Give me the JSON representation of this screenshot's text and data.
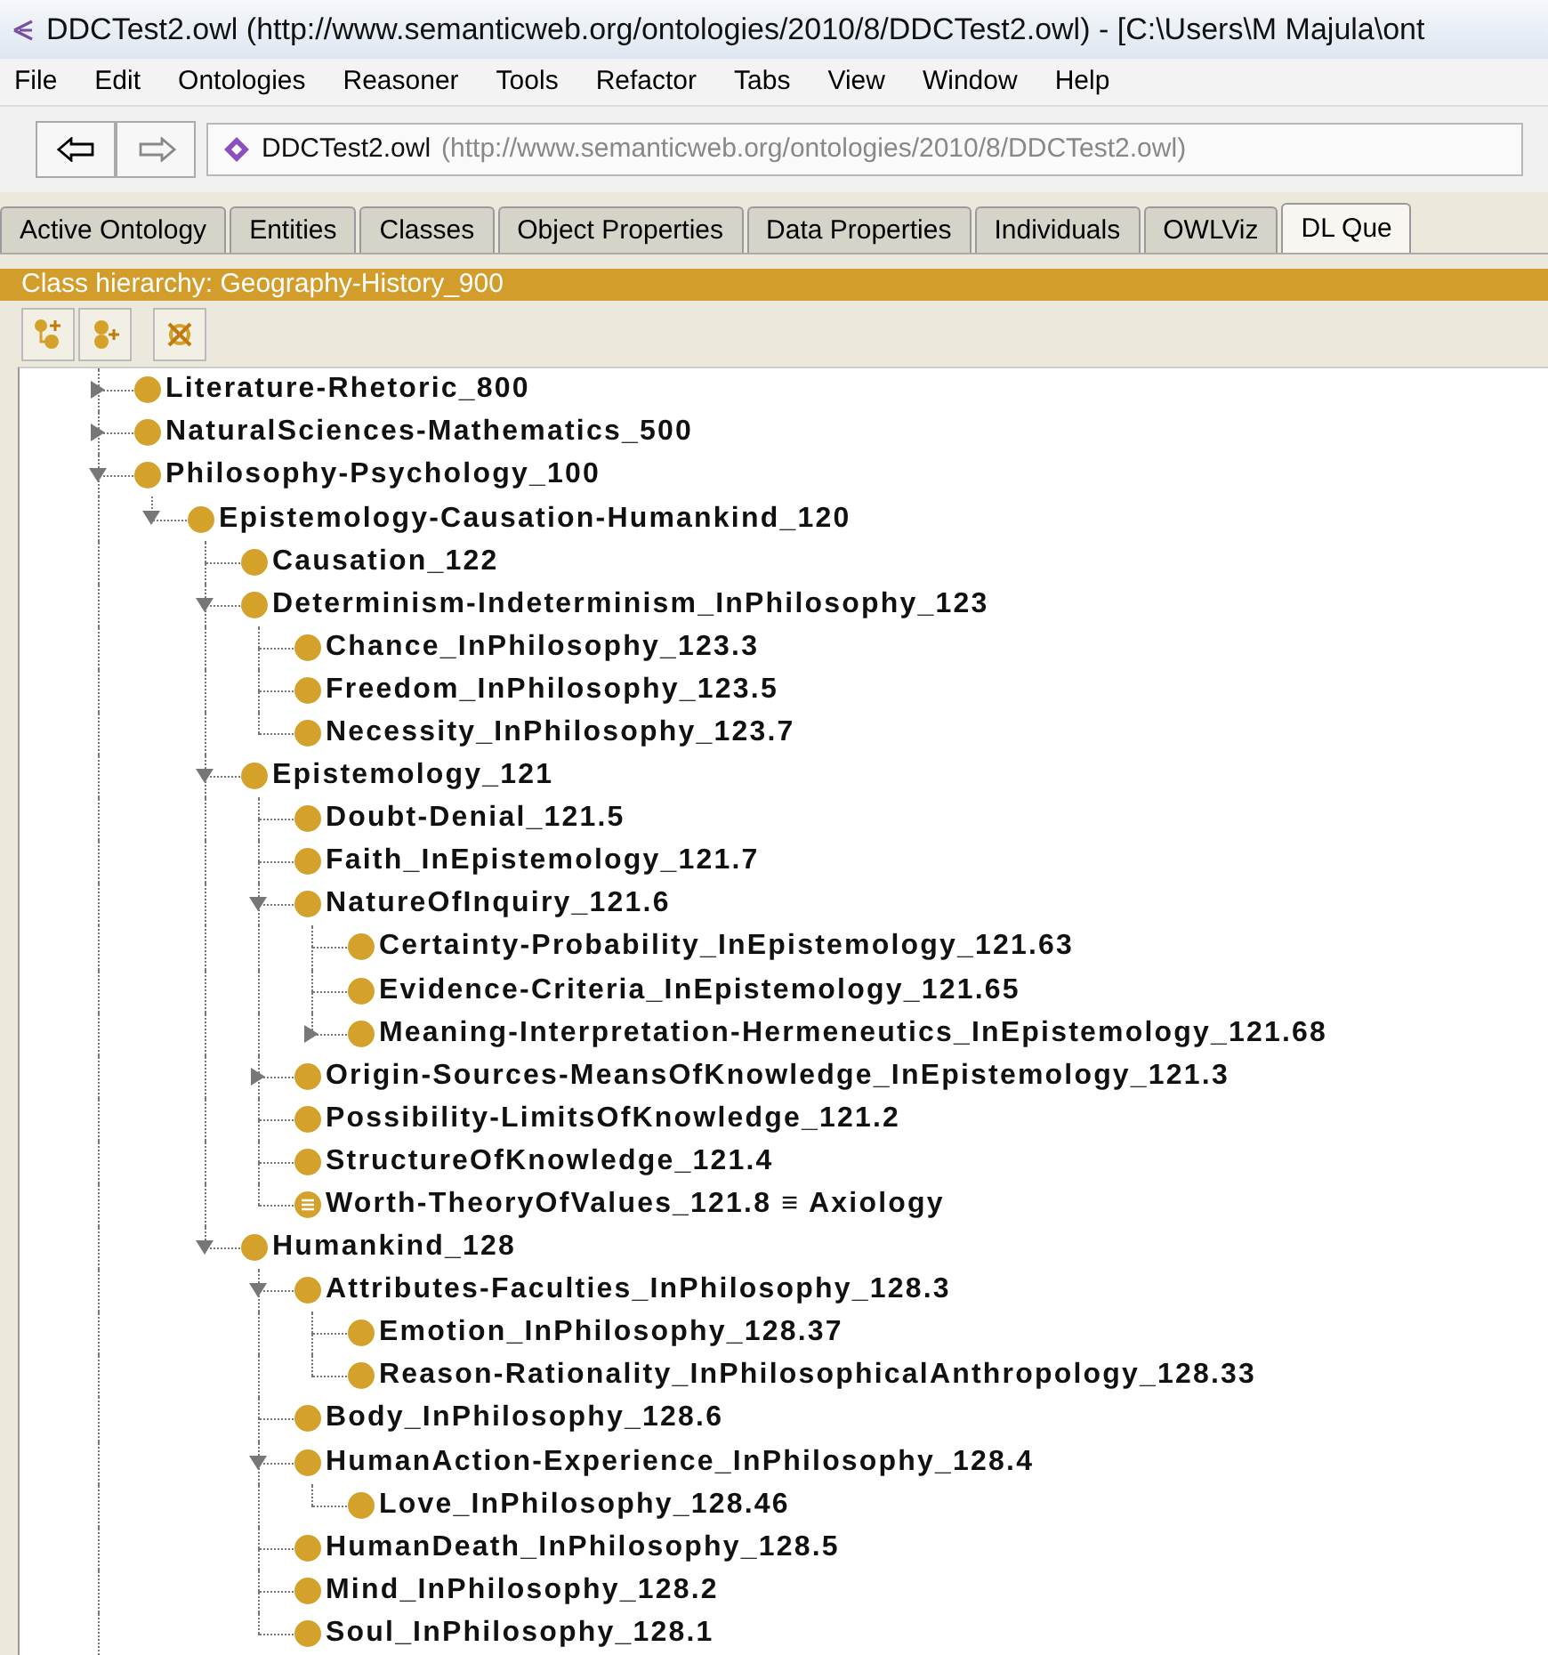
{
  "window": {
    "title": "DDCTest2.owl (http://www.semanticweb.org/ontologies/2010/8/DDCTest2.owl) - [C:\\Users\\M Majula\\ont"
  },
  "menu": [
    "File",
    "Edit",
    "Ontologies",
    "Reasoner",
    "Tools",
    "Refactor",
    "Tabs",
    "View",
    "Window",
    "Help"
  ],
  "address": {
    "name": "DDCTest2.owl",
    "iri": "(http://www.semanticweb.org/ontologies/2010/8/DDCTest2.owl)"
  },
  "tabs": [
    {
      "label": "Active Ontology",
      "selected": false
    },
    {
      "label": "Entities",
      "selected": false
    },
    {
      "label": "Classes",
      "selected": false
    },
    {
      "label": "Object Properties",
      "selected": false
    },
    {
      "label": "Data Properties",
      "selected": false
    },
    {
      "label": "Individuals",
      "selected": false
    },
    {
      "label": "OWLViz",
      "selected": false
    },
    {
      "label": "DL Que",
      "selected": true
    }
  ],
  "class_hierarchy": {
    "title": "Class hierarchy: Geography-History_900",
    "classes": [
      {
        "kind": "class",
        "name": "Literature-Rhetoric_800",
        "expanded": false
      },
      {
        "kind": "class",
        "name": "NaturalSciences-Mathematics_500",
        "expanded": false
      },
      {
        "kind": "class",
        "name": "Philosophy-Psychology_100",
        "expanded": true,
        "children": [
          {
            "kind": "class",
            "name": "Epistemology-Causation-Humankind_120",
            "expanded": true,
            "children": [
              {
                "kind": "class",
                "name": "Causation_122"
              },
              {
                "kind": "class",
                "name": "Determinism-Indeterminism_InPhilosophy_123",
                "expanded": true,
                "children": [
                  {
                    "kind": "class",
                    "name": "Chance_InPhilosophy_123.3"
                  },
                  {
                    "kind": "class",
                    "name": "Freedom_InPhilosophy_123.5"
                  },
                  {
                    "kind": "class",
                    "name": "Necessity_InPhilosophy_123.7"
                  }
                ]
              },
              {
                "kind": "class",
                "name": "Epistemology_121",
                "expanded": true,
                "children": [
                  {
                    "kind": "class",
                    "name": "Doubt-Denial_121.5"
                  },
                  {
                    "kind": "class",
                    "name": "Faith_InEpistemology_121.7"
                  },
                  {
                    "kind": "class",
                    "name": "NatureOfInquiry_121.6",
                    "expanded": true,
                    "children": [
                      {
                        "kind": "class",
                        "name": "Certainty-Probability_InEpistemology_121.63"
                      },
                      {
                        "kind": "class",
                        "name": "Evidence-Criteria_InEpistemology_121.65"
                      },
                      {
                        "kind": "class",
                        "name": "Meaning-Interpretation-Hermeneutics_InEpistemology_121.68",
                        "expanded": false
                      }
                    ]
                  },
                  {
                    "kind": "class",
                    "name": "Origin-Sources-MeansOfKnowledge_InEpistemology_121.3",
                    "expanded": false
                  },
                  {
                    "kind": "class",
                    "name": "Possibility-LimitsOfKnowledge_121.2"
                  },
                  {
                    "kind": "class",
                    "name": "StructureOfKnowledge_121.4"
                  },
                  {
                    "kind": "defined",
                    "name": "Worth-TheoryOfValues_121.8 ≡ Axiology"
                  }
                ]
              },
              {
                "kind": "class",
                "name": "Humankind_128",
                "expanded": true,
                "children": [
                  {
                    "kind": "class",
                    "name": "Attributes-Faculties_InPhilosophy_128.3",
                    "expanded": true,
                    "children": [
                      {
                        "kind": "class",
                        "name": "Emotion_InPhilosophy_128.37"
                      },
                      {
                        "kind": "class",
                        "name": "Reason-Rationality_InPhilosophicalAnthropology_128.33"
                      }
                    ]
                  },
                  {
                    "kind": "class",
                    "name": "Body_InPhilosophy_128.6"
                  },
                  {
                    "kind": "class",
                    "name": "HumanAction-Experience_InPhilosophy_128.4",
                    "expanded": true,
                    "children": [
                      {
                        "kind": "class",
                        "name": "Love_InPhilosophy_128.46"
                      }
                    ]
                  },
                  {
                    "kind": "class",
                    "name": "HumanDeath_InPhilosophy_128.5"
                  },
                  {
                    "kind": "class",
                    "name": "Mind_InPhilosophy_128.2"
                  },
                  {
                    "kind": "class",
                    "name": "Soul_InPhilosophy_128.1"
                  }
                ]
              }
            ]
          }
        ]
      }
    ]
  }
}
